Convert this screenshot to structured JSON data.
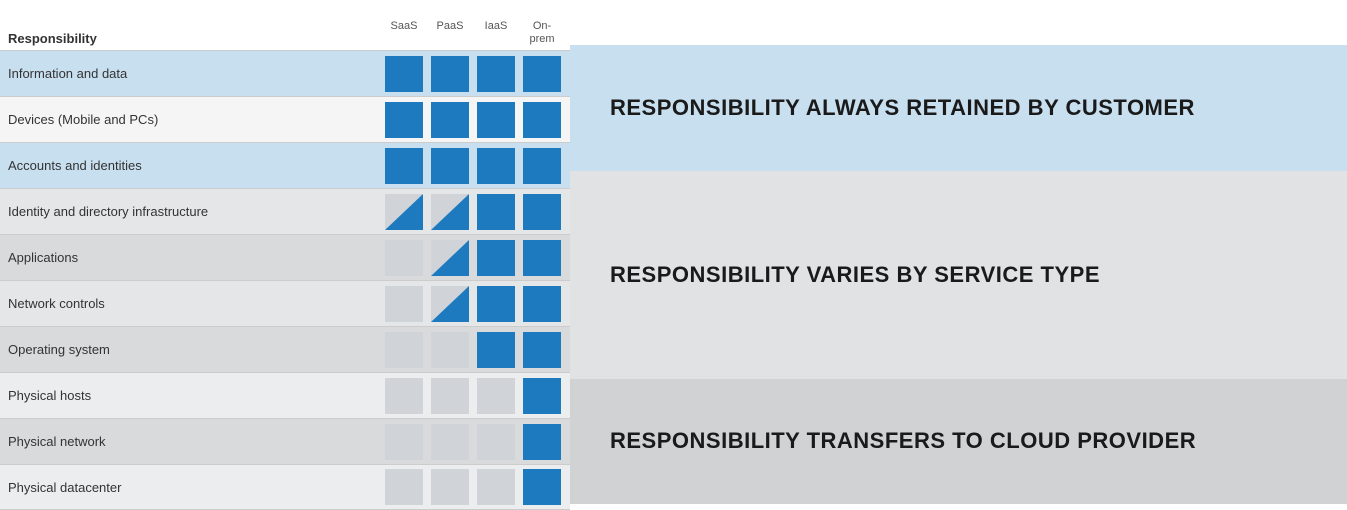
{
  "header": {
    "label": "Responsibility",
    "columns": [
      "SaaS",
      "PaaS",
      "IaaS",
      "On-\nprem"
    ]
  },
  "rows": [
    {
      "label": "Information and data",
      "bg": "blue-light",
      "cells": [
        "blue",
        "blue",
        "blue",
        "blue"
      ]
    },
    {
      "label": "Devices (Mobile and PCs)",
      "bg": "white",
      "cells": [
        "blue",
        "blue",
        "blue",
        "blue"
      ]
    },
    {
      "label": "Accounts and identities",
      "bg": "blue-light",
      "cells": [
        "blue",
        "blue",
        "blue",
        "blue"
      ]
    },
    {
      "label": "Identity and directory infrastructure",
      "bg": "gray-light",
      "cells": [
        "split",
        "split",
        "blue",
        "blue"
      ]
    },
    {
      "label": "Applications",
      "bg": "gray-medium",
      "cells": [
        "gray",
        "split",
        "blue",
        "blue"
      ]
    },
    {
      "label": "Network controls",
      "bg": "gray-light",
      "cells": [
        "gray",
        "split",
        "blue",
        "blue"
      ]
    },
    {
      "label": "Operating system",
      "bg": "gray-medium",
      "cells": [
        "gray",
        "gray",
        "blue",
        "blue"
      ]
    },
    {
      "label": "Physical hosts",
      "bg": "gray-lighter",
      "cells": [
        "gray",
        "gray",
        "gray",
        "blue"
      ]
    },
    {
      "label": "Physical network",
      "bg": "gray-medium",
      "cells": [
        "gray",
        "gray",
        "gray",
        "blue"
      ]
    },
    {
      "label": "Physical datacenter",
      "bg": "gray-lighter",
      "cells": [
        "gray",
        "gray",
        "gray",
        "blue"
      ]
    }
  ],
  "sections": {
    "always": {
      "label": "RESPONSIBILITY ALWAYS RETAINED BY CUSTOMER",
      "bg": "#c8dff0",
      "rows": 3
    },
    "varies": {
      "label": "RESPONSIBILITY VARIES BY SERVICE TYPE",
      "bg": "#e0e2e4",
      "rows": 5
    },
    "transfers": {
      "label": "RESPONSIBILITY TRANSFERS TO CLOUD PROVIDER",
      "bg": "#d0d2d4",
      "rows": 3
    }
  }
}
